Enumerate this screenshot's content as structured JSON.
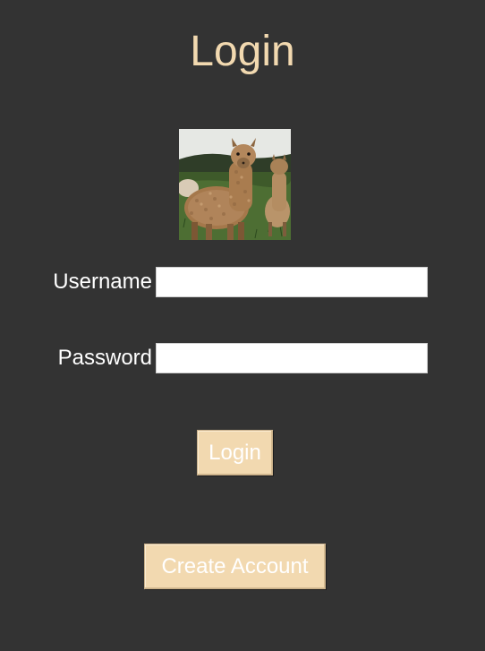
{
  "header": {
    "title": "Login"
  },
  "form": {
    "username_label": "Username",
    "username_value": "",
    "password_label": "Password",
    "password_value": ""
  },
  "actions": {
    "login_label": "Login",
    "create_account_label": "Create Account"
  },
  "colors": {
    "background": "#333333",
    "accent": "#f2d9b0",
    "label_text": "#ffffff"
  },
  "image": {
    "icon": "alpaca-photo"
  }
}
